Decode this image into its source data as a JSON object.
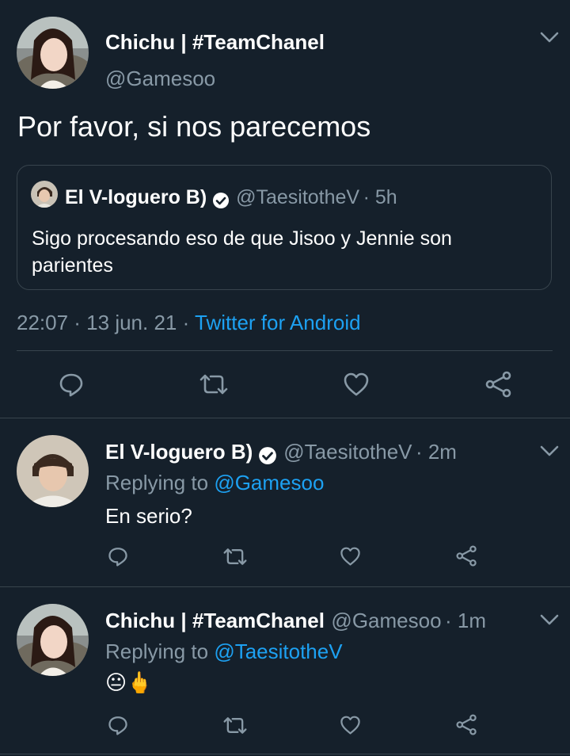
{
  "main_tweet": {
    "author_name": "Chichu | #TeamChanel",
    "author_handle": "@Gamesoo",
    "text": "Por favor, si nos parecemos",
    "quoted": {
      "author_name": "El V-loguero B)",
      "author_handle": "@TaesitotheV",
      "time": "· 5h",
      "text": "Sigo procesando eso de que Jisoo y Jennie son parientes"
    },
    "timestamp": "22:07 · 13 jun. 21 · ",
    "source": "Twitter for Android"
  },
  "replies": [
    {
      "author_name": "El V-loguero B)",
      "author_handle": "@TaesitotheV",
      "time": "· 2m",
      "replying_label": "Replying to ",
      "replying_to": "@Gamesoo",
      "text": "En serio?"
    },
    {
      "author_name": "Chichu | #TeamChanel",
      "author_handle": "@Gamesoo",
      "time": "· 1m",
      "replying_label": "Replying to ",
      "replying_to": "@TaesitotheV",
      "text": "😐🖕"
    }
  ],
  "icons": {
    "reply": "reply-icon",
    "retweet": "retweet-icon",
    "like": "heart-icon",
    "share": "share-icon",
    "menu": "chevron-down-icon",
    "verified": "verified-badge-icon"
  },
  "colors": {
    "background": "#15202b",
    "link": "#1da1f2",
    "muted": "#8899a6",
    "divider": "#38444d"
  }
}
